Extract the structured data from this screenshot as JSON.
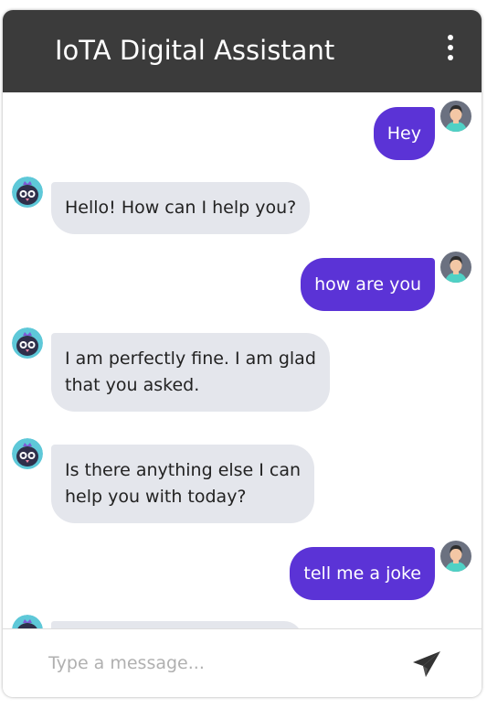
{
  "header": {
    "title": "IoTA Digital Assistant",
    "menu_icon": "more-vertical-icon"
  },
  "messages": [
    {
      "sender": "user",
      "text": "Hey"
    },
    {
      "sender": "bot",
      "text": "Hello! How can I help you?"
    },
    {
      "sender": "user",
      "text": "how are you"
    },
    {
      "sender": "bot",
      "lines": [
        "I am perfectly fine. I am glad",
        "that you asked."
      ]
    },
    {
      "sender": "bot",
      "lines": [
        "Is there anything else I can",
        "help you with today?"
      ]
    },
    {
      "sender": "user",
      "text": "tell me a joke"
    }
  ],
  "composer": {
    "placeholder": "Type a message...",
    "send_icon": "send-icon"
  },
  "colors": {
    "header_bg": "#3b3b3b",
    "user_bubble": "#5b33d6",
    "bot_bubble": "#e4e6ec",
    "bot_avatar": "#5ec8d8",
    "user_avatar": "#6b7180"
  }
}
